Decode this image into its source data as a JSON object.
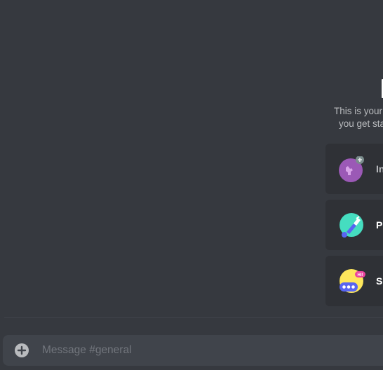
{
  "welcome": {
    "line1": "This is your",
    "line2": "you get sta"
  },
  "cards": [
    {
      "label": "In",
      "icon": "invite-friends-icon"
    },
    {
      "label": "Pe",
      "icon": "personalize-server-icon"
    },
    {
      "label": "Se",
      "icon": "send-first-message-icon"
    }
  ],
  "composer": {
    "placeholder": "Message #general",
    "attach_icon": "plus-circle-icon"
  },
  "colors": {
    "background": "#36393f",
    "card": "#2f3136",
    "input": "#40444b",
    "muted_text": "#b9bbbe",
    "placeholder": "#72767d"
  }
}
